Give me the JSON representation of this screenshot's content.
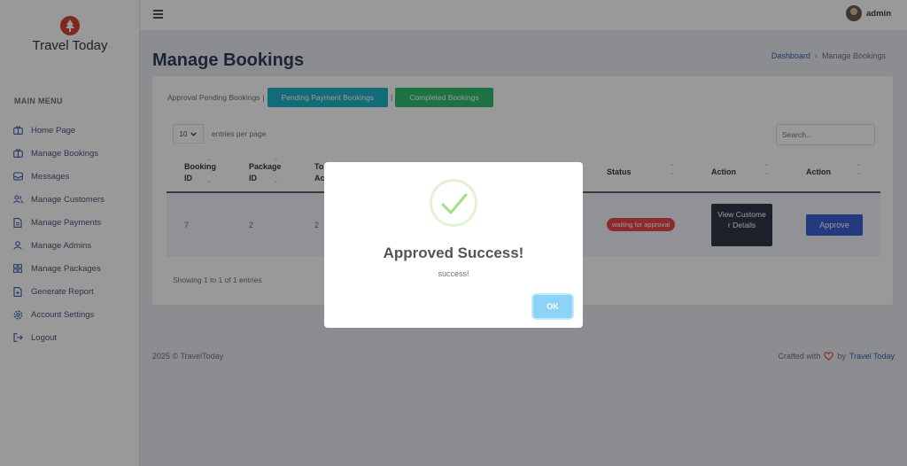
{
  "app": {
    "name": "Travel Today"
  },
  "sidebar": {
    "menu_title": "MAIN MENU",
    "items": [
      {
        "label": "Home Page",
        "icon": "briefcase-icon"
      },
      {
        "label": "Manage Bookings",
        "icon": "briefcase-icon"
      },
      {
        "label": "Messages",
        "icon": "inbox-icon"
      },
      {
        "label": "Manage Customers",
        "icon": "users-icon"
      },
      {
        "label": "Manage Payments",
        "icon": "document-icon"
      },
      {
        "label": "Manage Admins",
        "icon": "user-icon"
      },
      {
        "label": "Manage Packages",
        "icon": "grid-icon"
      },
      {
        "label": "Generate Report",
        "icon": "report-icon"
      },
      {
        "label": "Account Settings",
        "icon": "gear-icon"
      },
      {
        "label": "Logout",
        "icon": "logout-icon"
      }
    ]
  },
  "topbar": {
    "user_name": "admin"
  },
  "page": {
    "title": "Manage Bookings",
    "breadcrumb": {
      "home": "Dashboard",
      "separator": "›",
      "current": "Manage Bookings"
    }
  },
  "tabs": {
    "active_label": "Approval Pending Bookings",
    "separator": "|",
    "pending_payment": "Pending Payment Bookings",
    "completed": "Completed Bookings"
  },
  "table_controls": {
    "page_length": "10",
    "entries_label": "entries per page",
    "search_placeholder": "Search..."
  },
  "table": {
    "headers": {
      "booking_id": [
        "Booking",
        "ID"
      ],
      "package_id": [
        "Package",
        "ID"
      ],
      "col3_fragment": [
        "To",
        "Ac"
      ],
      "status": "Status",
      "action1": "Action",
      "action2": "Action"
    },
    "rows": [
      {
        "booking_id": "7",
        "package_id": "2",
        "col3": "2",
        "status": "waiting for approval",
        "view_label": "View Custome r Details",
        "approve_label": "Approve"
      }
    ],
    "info": "Showing 1 to 1 of 1 entries"
  },
  "footer": {
    "copyright": "2025 © TravelToday",
    "crafted_with": "Crafted with",
    "by": "by",
    "brand": "Travel Today"
  },
  "modal": {
    "title": "Approved Success!",
    "text": "success!",
    "ok_label": "OK"
  },
  "colors": {
    "accent": "#3b62d3",
    "teal": "#1fb5c7",
    "green": "#2fbf71",
    "badge_red": "#e8484a",
    "dark_button": "#313a46",
    "ok_button": "#8cd4f5",
    "logo_red": "#d6413a"
  }
}
